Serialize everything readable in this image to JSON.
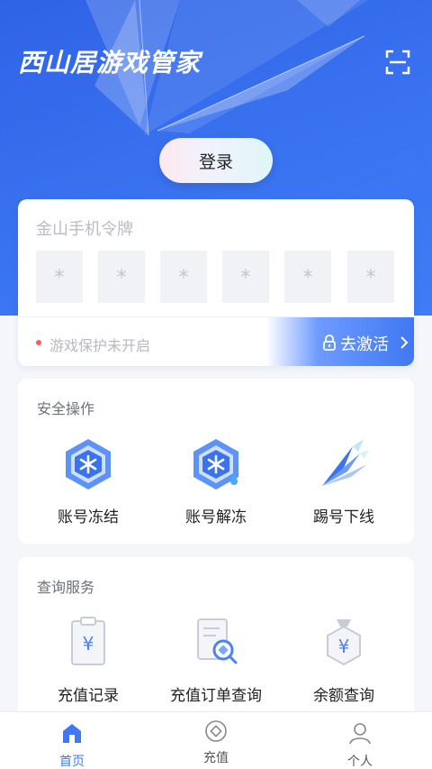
{
  "app": {
    "title": "西山居游戏管家"
  },
  "header": {
    "login_label": "登录",
    "scan_icon": "scan-icon"
  },
  "token": {
    "title": "金山手机令牌",
    "digits": [
      "*",
      "*",
      "*",
      "*",
      "*",
      "*"
    ],
    "status_text": "游戏保护未开启",
    "activate_label": "去激活"
  },
  "security": {
    "title": "安全操作",
    "items": [
      {
        "label": "账号冻结",
        "icon": "freeze-account-icon"
      },
      {
        "label": "账号解冻",
        "icon": "unfreeze-account-icon"
      },
      {
        "label": "踢号下线",
        "icon": "kick-offline-icon"
      }
    ]
  },
  "query": {
    "title": "查询服务",
    "items": [
      {
        "label": "充值记录",
        "icon": "recharge-record-icon"
      },
      {
        "label": "充值订单查询",
        "icon": "order-query-icon"
      },
      {
        "label": "余额查询",
        "icon": "balance-query-icon"
      }
    ]
  },
  "tabbar": {
    "items": [
      {
        "label": "首页",
        "icon": "home-icon",
        "active": true
      },
      {
        "label": "充值",
        "icon": "recharge-icon",
        "active": false
      },
      {
        "label": "个人",
        "icon": "user-icon",
        "active": false
      }
    ]
  },
  "colors": {
    "primary": "#3f78f2",
    "header_blue": "#3a73f0",
    "alert_red": "#ff5b5b",
    "page_bg": "#f4f6fa"
  }
}
